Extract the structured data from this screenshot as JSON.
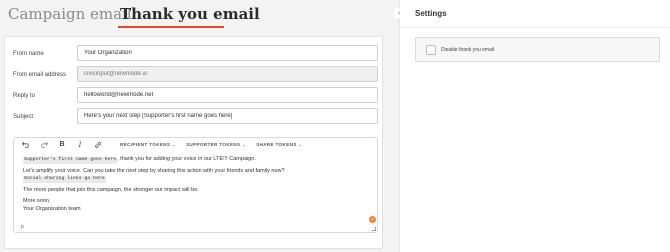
{
  "tabs": [
    {
      "label": "Campaign email",
      "active": false
    },
    {
      "label": "Thank you email",
      "active": true
    }
  ],
  "accent_color": "#e0452d",
  "form": {
    "from_name": {
      "label": "From name",
      "value": "Your Organization"
    },
    "from_email": {
      "label": "From email address",
      "value": "civicinput@newmode.io",
      "disabled": true
    },
    "reply_to": {
      "label": "Reply to",
      "value": "helloworld@newmode.net"
    },
    "subject": {
      "label": "Subject",
      "value": "Here's your next step [Supporter's first name goes here]"
    }
  },
  "toolbar": {
    "undo_icon": "undo-icon",
    "redo_icon": "redo-icon",
    "bold_label": "B",
    "italic_label": "I",
    "link_icon": "link-icon",
    "recipient_tokens": "RECIPIENT TOKENS",
    "supporter_tokens": "SUPPORTER TOKENS",
    "share_tokens": "SHARE TOKENS"
  },
  "editor": {
    "line1_token": "Supporter's first name goes here",
    "line1_text": ", thank you for adding your voice in our LTE!!! Campaign.",
    "line2_text": "Let's amplify your voice. Can you take the next step by sharing this action with your friends and family now?",
    "line3_token": "Social sharing links go here",
    "line4_text": "The more people that join this campaign, the stronger our impact will be.",
    "line5_text": "More soon,",
    "line6_text": "Your Organization team",
    "status_path": "p"
  },
  "settings": {
    "title": "Settings",
    "collapse_glyph": "›",
    "disable_thank_you_label": "Disable thank you email",
    "disable_thank_you_checked": false
  }
}
